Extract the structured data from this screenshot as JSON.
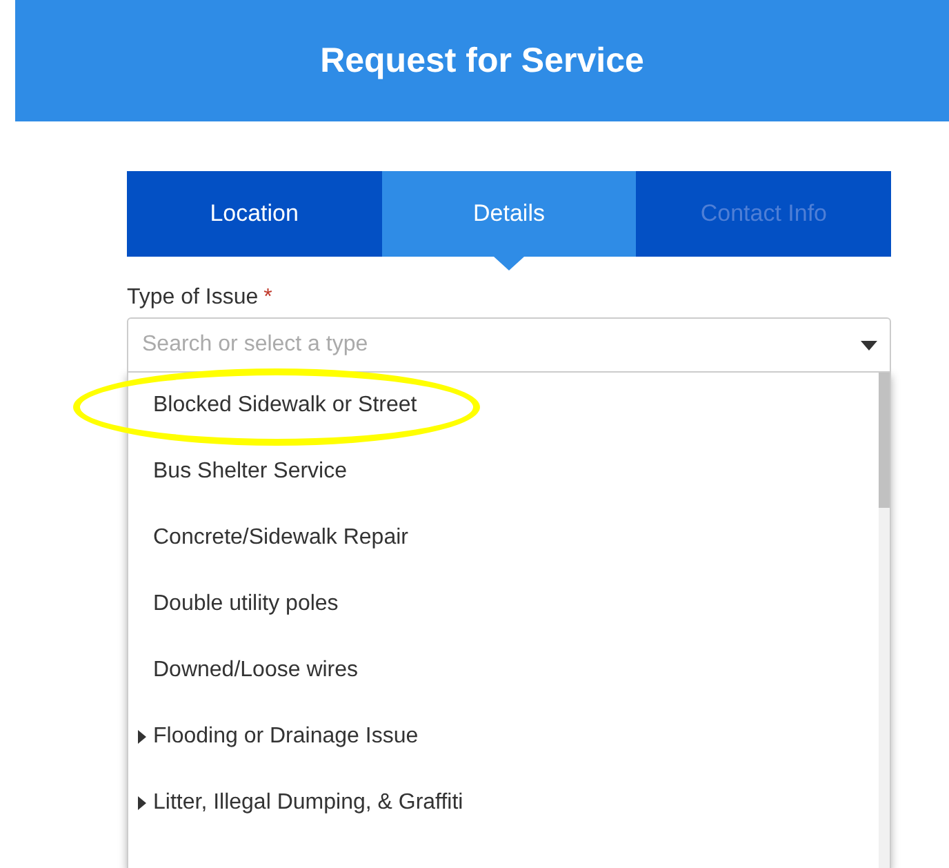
{
  "header": {
    "title": "Request for Service"
  },
  "tabs": [
    {
      "label": "Location",
      "selected": false,
      "disabled": false
    },
    {
      "label": "Details",
      "selected": true,
      "disabled": false
    },
    {
      "label": "Contact Info",
      "selected": false,
      "disabled": true
    }
  ],
  "field": {
    "label": "Type of Issue",
    "required_mark": "*",
    "placeholder": "Search or select a type"
  },
  "options": [
    {
      "label": "Blocked Sidewalk or Street",
      "has_children": false,
      "circled": true
    },
    {
      "label": "Bus Shelter Service",
      "has_children": false,
      "circled": false
    },
    {
      "label": "Concrete/Sidewalk Repair",
      "has_children": false,
      "circled": false
    },
    {
      "label": "Double utility poles",
      "has_children": false,
      "circled": false
    },
    {
      "label": "Downed/Loose wires",
      "has_children": false,
      "circled": false
    },
    {
      "label": "Flooding or Drainage Issue",
      "has_children": true,
      "circled": false
    },
    {
      "label": "Litter, Illegal Dumping, & Graffiti",
      "has_children": true,
      "circled": false
    }
  ]
}
